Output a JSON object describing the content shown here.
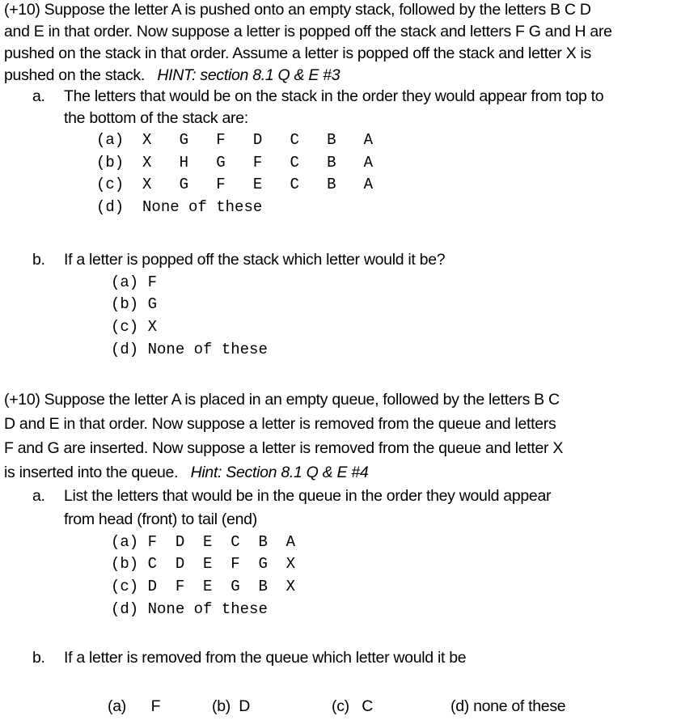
{
  "q1": {
    "lines": [
      "(+10) Suppose the letter A is pushed onto an empty stack, followed by the letters B  C  D",
      "and E in that order.  Now suppose a letter is popped off the stack and letters F  G and H are",
      "pushed on the stack in that order.   Assume a letter is popped off the stack and letter X is"
    ],
    "last_line": "pushed on the stack.",
    "hint": "HINT:  section 8.1 Q & E #3",
    "a": {
      "label": "a.",
      "lines": [
        "The letters that would be on the stack in the order they would appear from top to",
        "the bottom of the stack are:"
      ],
      "options": [
        {
          "label": "(a)",
          "text": "X   G   F   D   C   B   A"
        },
        {
          "label": "(b)",
          "text": "X   H   G   F   C   B   A"
        },
        {
          "label": "(c)",
          "text": "X   G   F   E   C   B   A"
        },
        {
          "label": "(d)",
          "text": "None of these"
        }
      ]
    },
    "b": {
      "label": "b.",
      "text": "If a letter is popped off the stack which letter would it be?",
      "options": [
        {
          "label": "(a)",
          "text": "F"
        },
        {
          "label": "(b)",
          "text": "G"
        },
        {
          "label": "(c)",
          "text": "X"
        },
        {
          "label": "(d)",
          "text": "None of these"
        }
      ]
    }
  },
  "q2": {
    "lines": [
      "(+10)  Suppose the letter A is placed in an empty queue, followed by the letters B  C",
      "D  and E in that order.  Now suppose a letter is removed from the queue and letters",
      "F and G are inserted.  Now suppose a letter is removed from the queue and letter X"
    ],
    "last_line": "is inserted into the queue.",
    "hint": "Hint:  Section 8.1 Q & E #4",
    "a": {
      "label": "a.",
      "lines": [
        "List the letters that would be in the queue in the order they would appear",
        "from head (front) to tail  (end)"
      ],
      "options": [
        {
          "label": "(a)",
          "text": "F  D  E  C  B  A"
        },
        {
          "label": "(b)",
          "text": "C  D  E  F  G  X"
        },
        {
          "label": "(c)",
          "text": "D  F  E  G  B  X"
        },
        {
          "label": "(d)",
          "text": "None of these"
        }
      ]
    },
    "b": {
      "label": "b.",
      "text": "If a letter is removed from the queue which letter would it be",
      "options": [
        {
          "label": "(a)",
          "text": "F"
        },
        {
          "label": "(b)",
          "text": "D"
        },
        {
          "label": "(c)",
          "text": "C"
        },
        {
          "label": "(d)",
          "text": "none of these"
        }
      ]
    }
  }
}
